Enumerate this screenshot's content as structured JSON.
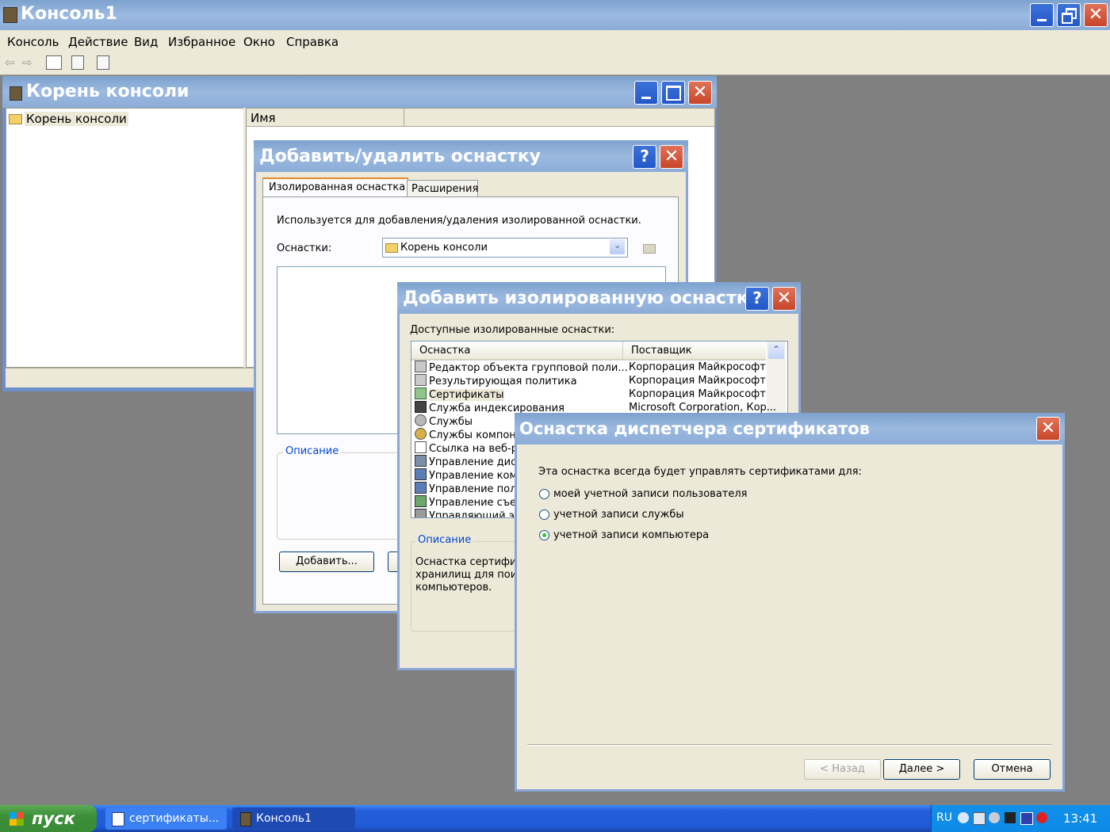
{
  "main_window": {
    "title": "Консоль1",
    "menu": [
      "Консоль",
      "Действие",
      "Вид",
      "Избранное",
      "Окно",
      "Справка"
    ]
  },
  "child_window": {
    "title": "Корень консоли",
    "tree_root": "Корень консоли",
    "column_name": "Имя"
  },
  "add_remove_dialog": {
    "title": "Добавить/удалить оснастку",
    "help": "?",
    "tabs": [
      "Изолированная оснастка",
      "Расширения"
    ],
    "description_text": "Используется для добавления/удаления изолированной оснастки.",
    "snapins_label": "Оснастки:",
    "snapins_value": "Корень консоли",
    "description_group": "Описание",
    "add_button": "Добавить..."
  },
  "add_standalone_dialog": {
    "title": "Добавить изолированную оснастку",
    "help": "?",
    "available_label": "Доступные изолированные оснастки:",
    "col_snapin": "Оснастка",
    "col_vendor": "Поставщик",
    "items": [
      {
        "name": "Редактор объекта групповой поли...",
        "vendor": "Корпорация Майкрософт",
        "icon": "policy-icon"
      },
      {
        "name": "Результирующая политика",
        "vendor": "Корпорация Майкрософт",
        "icon": "policy-icon"
      },
      {
        "name": "Сертификаты",
        "vendor": "Корпорация Майкрософт",
        "icon": "certificate-icon"
      },
      {
        "name": "Служба индексирования",
        "vendor": "Microsoft Corporation, Кор...",
        "icon": "index-icon"
      },
      {
        "name": "Службы",
        "vendor": "",
        "icon": "services-icon"
      },
      {
        "name": "Службы компоне",
        "vendor": "",
        "icon": "components-icon"
      },
      {
        "name": "Ссылка на веб-р",
        "vendor": "",
        "icon": "link-icon"
      },
      {
        "name": "Управление дис",
        "vendor": "",
        "icon": "disk-icon"
      },
      {
        "name": "Управление ком",
        "vendor": "",
        "icon": "computer-icon"
      },
      {
        "name": "Управление пол",
        "vendor": "",
        "icon": "computer-icon"
      },
      {
        "name": "Управление съе",
        "vendor": "",
        "icon": "storage-icon"
      },
      {
        "name": "Управляющий эл",
        "vendor": "",
        "icon": "control-icon"
      }
    ],
    "description_group": "Описание",
    "description_lines": [
      "Оснастка сертифи",
      "хранилищ для поис",
      "компьютеров."
    ]
  },
  "cert_dialog": {
    "title": "Оснастка диспетчера сертификатов",
    "prompt": "Эта оснастка всегда будет управлять сертификатами для:",
    "options": [
      {
        "label": "моей учетной записи пользователя",
        "selected": false
      },
      {
        "label": "учетной записи службы",
        "selected": false
      },
      {
        "label": "учетной записи компьютера",
        "selected": true
      }
    ],
    "back_button": "< Назад",
    "next_button": "Далее >",
    "cancel_button": "Отмена"
  },
  "taskbar": {
    "start": "пуск",
    "tasks": [
      "сертификаты...",
      "Консоль1"
    ],
    "lang": "RU",
    "clock": "13:41"
  }
}
